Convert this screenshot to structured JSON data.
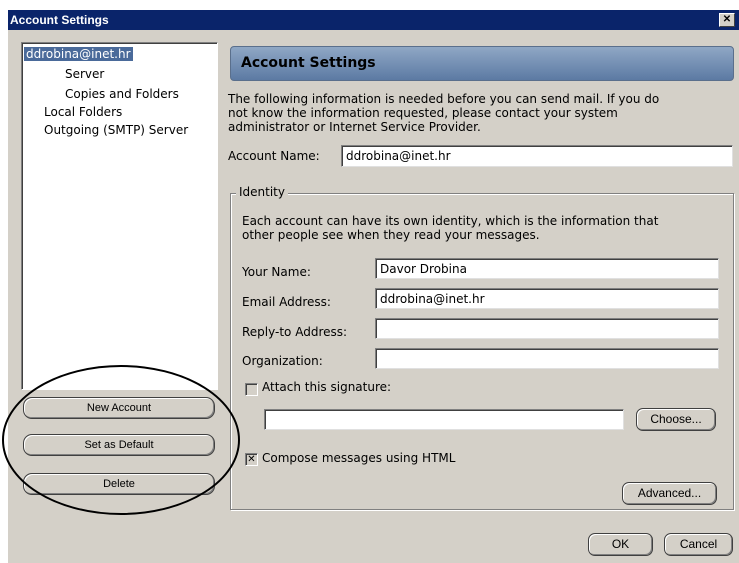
{
  "window": {
    "title": "Account Settings",
    "close_glyph": "✕"
  },
  "tree": {
    "items": [
      {
        "label": "ddrobina@inet.hr",
        "selected": true
      },
      {
        "label": "Server"
      },
      {
        "label": "Copies and Folders"
      },
      {
        "label": "Local Folders"
      },
      {
        "label": "Outgoing (SMTP) Server"
      }
    ]
  },
  "side_buttons": {
    "new_account": "New Account",
    "set_default": "Set as Default",
    "delete": "Delete"
  },
  "panel": {
    "header": "Account Settings",
    "intro_line1": "The following information is needed before you can send mail. If you do",
    "intro_line2": "not know the information requested, please contact your system",
    "intro_line3": "administrator or Internet Service Provider.",
    "account_name_label": "Account Name:",
    "account_name_value": "ddrobina@inet.hr"
  },
  "identity": {
    "legend": "Identity",
    "desc_line1": "Each account can have its own identity, which is the information that",
    "desc_line2": "other people see when they read your messages.",
    "your_name_label": "Your Name:",
    "your_name_value": "Davor Drobina",
    "email_label": "Email Address:",
    "email_value": "ddrobina@inet.hr",
    "reply_to_label": "Reply-to Address:",
    "reply_to_value": "",
    "organization_label": "Organization:",
    "organization_value": "",
    "attach_signature_label": "Attach this signature:",
    "attach_signature_checked": false,
    "signature_path": "",
    "choose_button": "Choose...",
    "compose_html_label": "Compose messages using HTML",
    "compose_html_checked": true,
    "compose_check_glyph": "✕",
    "advanced_button": "Advanced..."
  },
  "footer": {
    "ok": "OK",
    "cancel": "Cancel"
  },
  "colors": {
    "titlebar": "#0a246a",
    "selection": "#4a6a9a",
    "annotation": "#000000"
  }
}
